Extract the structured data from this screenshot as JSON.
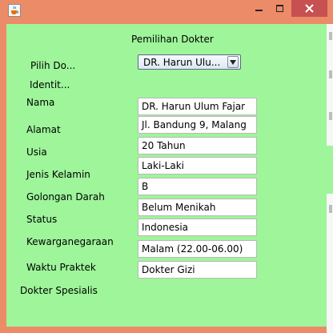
{
  "form": {
    "heading": "Pemilihan Dokter",
    "pilih_label": "Pilih Do...",
    "dokter_selected": "DR. Harun Ulu...",
    "identitas_label": "Identit...",
    "spesialis_label": "Dokter Spesialis"
  },
  "fields": [
    {
      "label": "Nama",
      "value": "DR. Harun Ulum Fajar"
    },
    {
      "label": "Alamat",
      "value": "Jl. Bandung 9, Malang"
    },
    {
      "label": "Usia",
      "value": "20 Tahun"
    },
    {
      "label": "Jenis Kelamin",
      "value": "Laki-Laki"
    },
    {
      "label": "Golongan Darah",
      "value": "B"
    },
    {
      "label": "Status",
      "value": "Belum Menikah"
    },
    {
      "label": "Kewarganegaraan",
      "value": "Indonesia"
    },
    {
      "label": "Waktu Praktek",
      "value": " Malam (22.00-06.00)"
    },
    {
      "label": "",
      "value": "Dokter Gizi"
    }
  ],
  "icons": {
    "app": "java-cup-icon",
    "minimize": "minimize-icon",
    "maximize": "maximize-icon",
    "close": "close-icon",
    "dropdown": "chevron-down-icon"
  },
  "colors": {
    "titlebar": "#ec8b68",
    "content_background": "#9ef59a",
    "close_button": "#c75050"
  }
}
